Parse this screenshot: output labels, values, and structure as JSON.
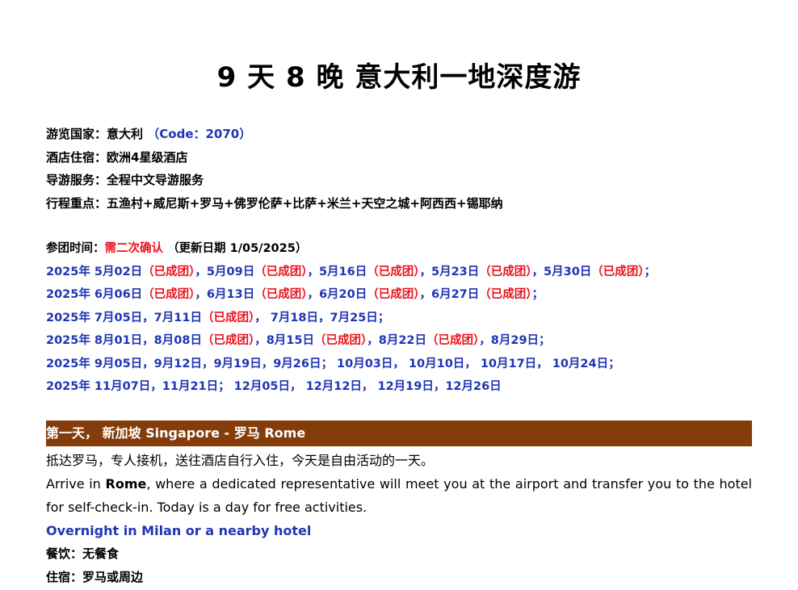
{
  "title": "9 天 8 晚 意大利一地深度游",
  "info": {
    "country_label": "游览国家：",
    "country_value": "意大利",
    "country_code": "（Code：2070）",
    "hotel_label": "酒店住宿：",
    "hotel_value": "欧洲4星级酒店",
    "guide_label": "导游服务：",
    "guide_value": "全程中文导游服务",
    "highlights_label": "行程重点：",
    "highlights_value": "五渔村+威尼斯+罗马+佛罗伦萨+比萨+米兰+天空之城+阿西西+锡耶纳"
  },
  "dates": {
    "label": "参团时间：",
    "confirm": "需二次确认",
    "update": "（更新日期 1/05/2025）",
    "rows": [
      [
        {
          "t": "2025年  5月02日",
          "c": "b"
        },
        {
          "t": "（已成团）",
          "c": "r"
        },
        {
          "t": "，5月09日",
          "c": "b"
        },
        {
          "t": "（已成团）",
          "c": "r"
        },
        {
          "t": "，5月16日",
          "c": "b"
        },
        {
          "t": "（已成团）",
          "c": "r"
        },
        {
          "t": "，5月23日",
          "c": "b"
        },
        {
          "t": "（已成团）",
          "c": "r"
        },
        {
          "t": "，5月30日",
          "c": "b"
        },
        {
          "t": "（已成团）",
          "c": "r"
        },
        {
          "t": "；",
          "c": "b"
        }
      ],
      [
        {
          "t": "2025年  6月06日",
          "c": "b"
        },
        {
          "t": "（已成团）",
          "c": "r"
        },
        {
          "t": "，6月13日",
          "c": "b"
        },
        {
          "t": "（已成团）",
          "c": "r"
        },
        {
          "t": "，6月20日",
          "c": "b"
        },
        {
          "t": "（已成团）",
          "c": "r"
        },
        {
          "t": "，6月27日",
          "c": "b"
        },
        {
          "t": "（已成团）",
          "c": "r"
        },
        {
          "t": "；",
          "c": "b"
        }
      ],
      [
        {
          "t": "2025年  7月05日，7月11日",
          "c": "b"
        },
        {
          "t": "（已成团）",
          "c": "r"
        },
        {
          "t": "， 7月18日，7月25日；",
          "c": "b"
        }
      ],
      [
        {
          "t": "2025年  8月01日，8月08日",
          "c": "b"
        },
        {
          "t": "（已成团）",
          "c": "r"
        },
        {
          "t": "，8月15日",
          "c": "b"
        },
        {
          "t": "（已成团）",
          "c": "r"
        },
        {
          "t": "，8月22日",
          "c": "b"
        },
        {
          "t": "（已成团）",
          "c": "r"
        },
        {
          "t": "，8月29日；",
          "c": "b"
        }
      ],
      [
        {
          "t": "2025年  9月05日，9月12日，9月19日，9月26日； 10月03日， 10月10日， 10月17日， 10月24日；",
          "c": "b"
        }
      ],
      [
        {
          "t": "2025年  11月07日，11月21日； 12月05日， 12月12日， 12月19日，12月26日",
          "c": "b"
        }
      ]
    ]
  },
  "day1": {
    "header": "第一天，  新加坡 Singapore - 罗马 Rome",
    "cn_text": "抵达罗马，专人接机，送往酒店自行入住，今天是自由活动的一天。",
    "en_prefix": "Arrive in ",
    "en_bold": "Rome",
    "en_rest": ", where a dedicated representative will meet you at the airport and transfer you to the hotel for self-check-in. Today is a day for free activities.",
    "overnight": "Overnight in Milan or a nearby hotel",
    "meal": "餐饮：无餐食",
    "stay": "住宿：罗马或周边"
  }
}
